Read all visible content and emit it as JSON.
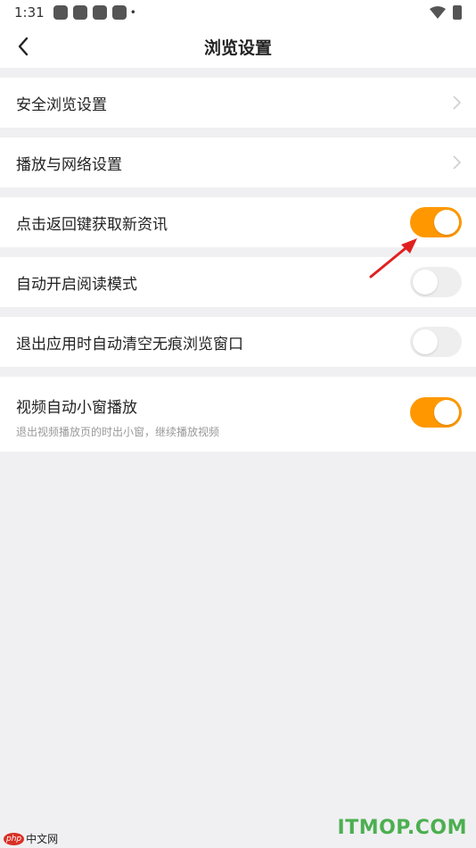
{
  "status_bar": {
    "time": "1:31",
    "notification_icons": [
      "app-icon",
      "app-icon",
      "app-icon",
      "app-icon"
    ],
    "dot": "•"
  },
  "header": {
    "title": "浏览设置",
    "back_icon": "back-arrow-icon"
  },
  "settings": [
    {
      "label": "安全浏览设置",
      "type": "link"
    },
    {
      "label": "播放与网络设置",
      "type": "link"
    },
    {
      "label": "点击返回键获取新资讯",
      "type": "toggle",
      "on": true
    },
    {
      "label": "自动开启阅读模式",
      "type": "toggle",
      "on": false
    },
    {
      "label": "退出应用时自动清空无痕浏览窗口",
      "type": "toggle",
      "on": false
    },
    {
      "label": "视频自动小窗播放",
      "sublabel": "退出视频播放页的时出小窗，继续播放视频",
      "type": "toggle",
      "on": true
    }
  ],
  "colors": {
    "accent": "#ff9800",
    "annotation_arrow": "#e02020",
    "background": "#f0f0f2"
  },
  "watermarks": {
    "left_badge": "php",
    "left_text": "中文网",
    "right_text": "ITMOP.COM"
  }
}
